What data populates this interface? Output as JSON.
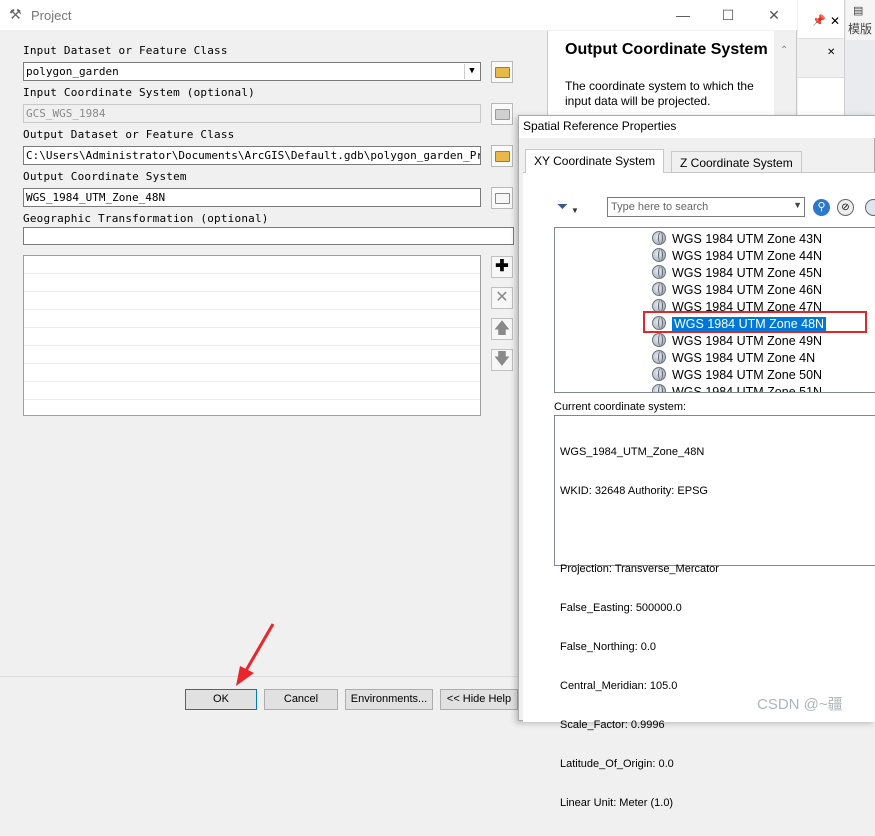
{
  "project": {
    "title": "Project",
    "input_dataset_label": "Input Dataset or Feature Class",
    "input_dataset_value": "polygon_garden",
    "input_coord_label": "Input Coordinate System (optional)",
    "input_coord_value": "GCS_WGS_1984",
    "output_dataset_label": "Output Dataset or Feature Class",
    "output_dataset_value": "C:\\Users\\Administrator\\Documents\\ArcGIS\\Default.gdb\\polygon_garden_Project",
    "output_coord_label": "Output Coordinate System",
    "output_coord_value": "WGS_1984_UTM_Zone_48N",
    "geo_transform_label": "Geographic Transformation (optional)",
    "buttons": {
      "ok": "OK",
      "cancel": "Cancel",
      "environments": "Environments...",
      "hide_help": "<< Hide Help"
    }
  },
  "help": {
    "title": "Output Coordinate System",
    "body": "The coordinate system to which the input data will be projected."
  },
  "dock": {
    "side_label": "模版"
  },
  "srp": {
    "title": "Spatial Reference Properties",
    "tabs": [
      "XY Coordinate System",
      "Z Coordinate System"
    ],
    "search_placeholder": "Type here to search",
    "crs_items": [
      "WGS 1984 UTM Zone 43N",
      "WGS 1984 UTM Zone 44N",
      "WGS 1984 UTM Zone 45N",
      "WGS 1984 UTM Zone 46N",
      "WGS 1984 UTM Zone 47N",
      "WGS 1984 UTM Zone 48N",
      "WGS 1984 UTM Zone 49N",
      "WGS 1984 UTM Zone 4N",
      "WGS 1984 UTM Zone 50N",
      "WGS 1984 UTM Zone 51N"
    ],
    "selected_item": "WGS 1984 UTM Zone 48N",
    "current_label": "Current coordinate system:",
    "current_lines": [
      "WGS_1984_UTM_Zone_48N",
      "WKID: 32648 Authority: EPSG",
      "",
      "Projection: Transverse_Mercator",
      "False_Easting: 500000.0",
      "False_Northing: 0.0",
      "Central_Meridian: 105.0",
      "Scale_Factor: 0.9996",
      "Latitude_Of_Origin: 0.0",
      "Linear Unit: Meter (1.0)"
    ]
  },
  "watermark": "CSDN @~疆"
}
